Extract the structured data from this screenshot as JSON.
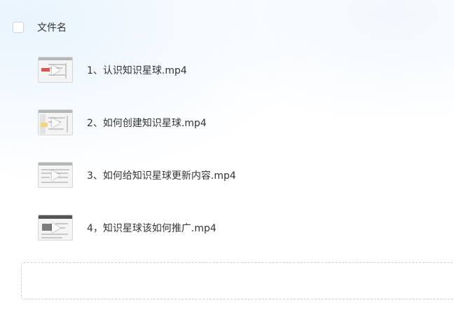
{
  "header": {
    "column_label": "文件名"
  },
  "files": [
    {
      "name": "1、认识知识星球.mp4",
      "icon": "video-thumbnail-icon"
    },
    {
      "name": "2、如何创建知识星球.mp4",
      "icon": "video-thumbnail-icon"
    },
    {
      "name": "3、如何给知识星球更新内容.mp4",
      "icon": "video-thumbnail-icon"
    },
    {
      "name": "4，知识星球该如何推广.mp4",
      "icon": "video-thumbnail-icon"
    }
  ]
}
